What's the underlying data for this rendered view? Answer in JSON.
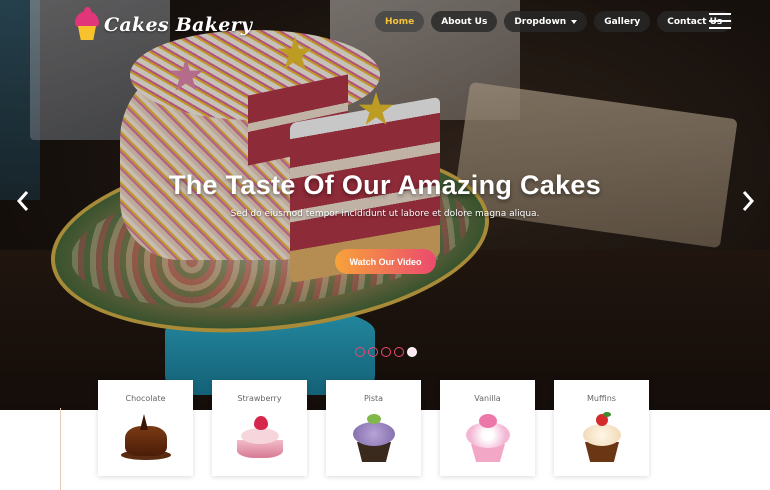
{
  "brand": {
    "name": "Cakes Bakery"
  },
  "nav": {
    "items": [
      {
        "label": "Home",
        "active": true
      },
      {
        "label": "About Us",
        "active": false
      },
      {
        "label": "Dropdown",
        "active": false,
        "has_caret": true
      },
      {
        "label": "Gallery",
        "active": false
      },
      {
        "label": "Contact Us",
        "active": false
      }
    ],
    "menu_icon": "hamburger-menu-icon"
  },
  "hero": {
    "title": "The Taste Of Our Amazing Cakes",
    "subtitle": "Sed do eiusmod tempor incididunt ut labore et dolore magna aliqua.",
    "cta_label": "Watch Our Video",
    "prev_icon": "chevron-left-icon",
    "next_icon": "chevron-right-icon",
    "slides_total": 5,
    "active_slide": 5
  },
  "categories": [
    {
      "label": "Chocolate",
      "icon": "chocolate-cake-image"
    },
    {
      "label": "Strawberry",
      "icon": "strawberry-cake-image"
    },
    {
      "label": "Pista",
      "icon": "pista-cupcake-image"
    },
    {
      "label": "Vanilla",
      "icon": "vanilla-cupcake-image"
    },
    {
      "label": "Muffins",
      "icon": "muffin-image"
    }
  ],
  "colors": {
    "accent_yellow": "#f5c339",
    "accent_pink": "#ec4a6e",
    "cta_gradient_start": "#f7a33a",
    "cta_gradient_end": "#ec4a6e",
    "nav_pill_bg": "#282828"
  }
}
